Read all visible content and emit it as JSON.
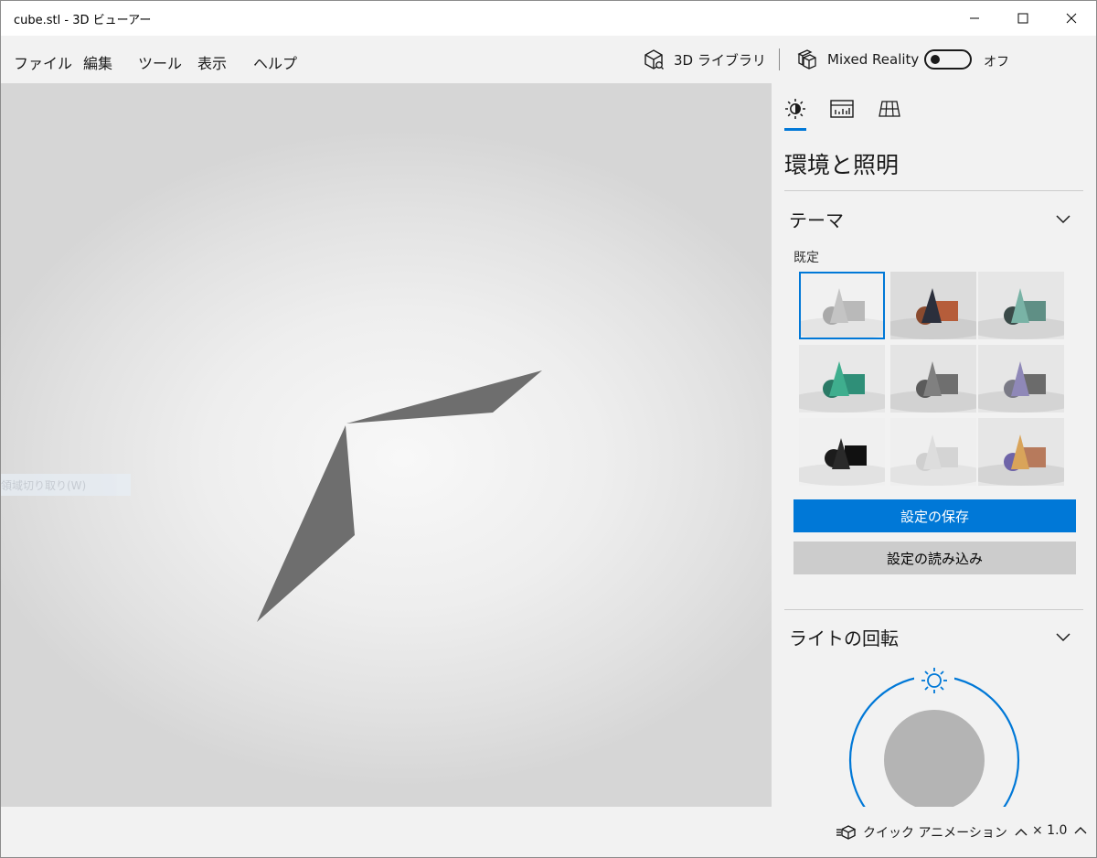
{
  "window": {
    "title": "cube.stl - 3D ビューアー",
    "controls": [
      "minimize",
      "maximize",
      "close"
    ]
  },
  "menu": {
    "items": [
      "ファイル",
      "編集",
      "ツール",
      "表示",
      "ヘルプ"
    ],
    "library_label": "3D ライブラリ",
    "mixed_reality_label": "Mixed Reality",
    "toggle_state": "オフ",
    "toggle_on": false
  },
  "viewport": {
    "ghost_menu_text": "領域切り取り(W)",
    "model_color": "#6e6e6e"
  },
  "panel": {
    "tabs": [
      {
        "name": "environment-lighting",
        "icon": "sun-icon",
        "selected": true
      },
      {
        "name": "stats",
        "icon": "stats-icon",
        "selected": false
      },
      {
        "name": "grid",
        "icon": "grid-icon",
        "selected": false
      }
    ],
    "title": "環境と照明",
    "theme_section": "テーマ",
    "theme_sub_label": "既定",
    "themes": [
      {
        "name": "default-gray",
        "selected": true
      },
      {
        "name": "dark-orange"
      },
      {
        "name": "teal-dark"
      },
      {
        "name": "green-teal"
      },
      {
        "name": "dark-gray"
      },
      {
        "name": "purple"
      },
      {
        "name": "black"
      },
      {
        "name": "white"
      },
      {
        "name": "gold-purple"
      }
    ],
    "save_button": "設定の保存",
    "load_button": "設定の読み込み",
    "light_section": "ライトの回転",
    "accent_color": "#0078d7"
  },
  "bottom": {
    "quick_animation_label": "クイック アニメーション",
    "speed_label": "× 1.0"
  }
}
